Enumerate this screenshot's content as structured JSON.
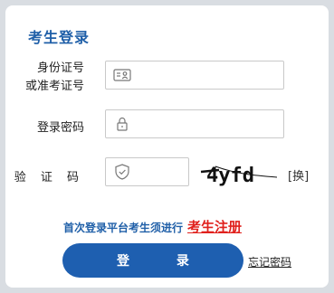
{
  "form": {
    "title": "考生登录",
    "id_label_line1": "身份证号",
    "id_label_line2": "或准考证号",
    "id_value": "",
    "password_label": "登录密码",
    "password_value": "",
    "captcha_label": "验 证 码",
    "captcha_value": "",
    "captcha_image_text": "4yfd",
    "refresh_label": "[换]",
    "register_tip": "首次登录平台考生须进行",
    "register_link": "考生注册",
    "login_button": "登 录",
    "forgot_password": "忘记密码"
  },
  "icons": {
    "id_field": "id-card-icon",
    "password_field": "lock-icon",
    "captcha_field": "shield-check-icon"
  },
  "colors": {
    "accent": "#1f5fa8",
    "button": "#1e5fb0",
    "register": "#e0211d"
  }
}
